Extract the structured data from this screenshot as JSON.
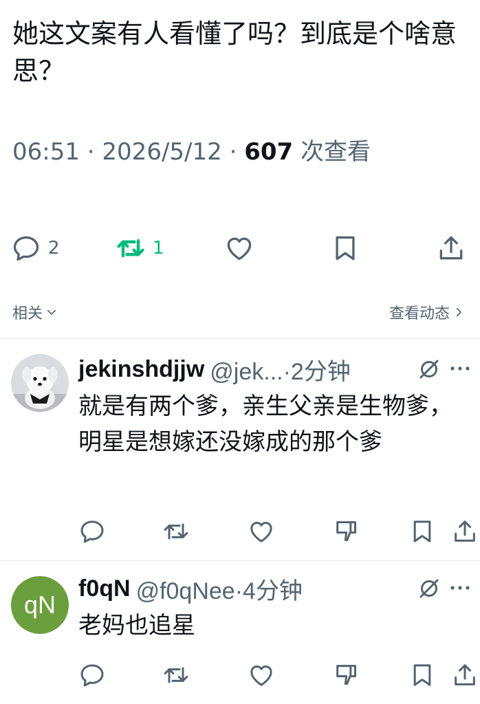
{
  "post": {
    "text": "她这文案有人看懂了吗？到底是个啥意思？",
    "time": "06:51",
    "sep1": " · ",
    "date": "2026/5/12",
    "sep2": " · ",
    "views": "607",
    "views_label": " 次查看"
  },
  "actions": {
    "reply_count": "2",
    "retweet_count": "1"
  },
  "related": {
    "label": "相关",
    "activity_label": "查看动态"
  },
  "replies": [
    {
      "author": "jekinshdjjw",
      "handle": "@jek...·2分钟",
      "text": "就是有两个爹，亲生父亲是生物爹，明星是想嫁还没嫁成的那个爹"
    },
    {
      "author": "f0qN",
      "avatar_text": "qN",
      "handle": "@f0qNee·4分钟",
      "text": "老妈也追星"
    }
  ],
  "colors": {
    "text": "#0f1419",
    "secondary": "#536471",
    "retweet_green": "#00ba7c",
    "avatar_green": "#6b9e3c",
    "divider": "#e5e8eb"
  }
}
